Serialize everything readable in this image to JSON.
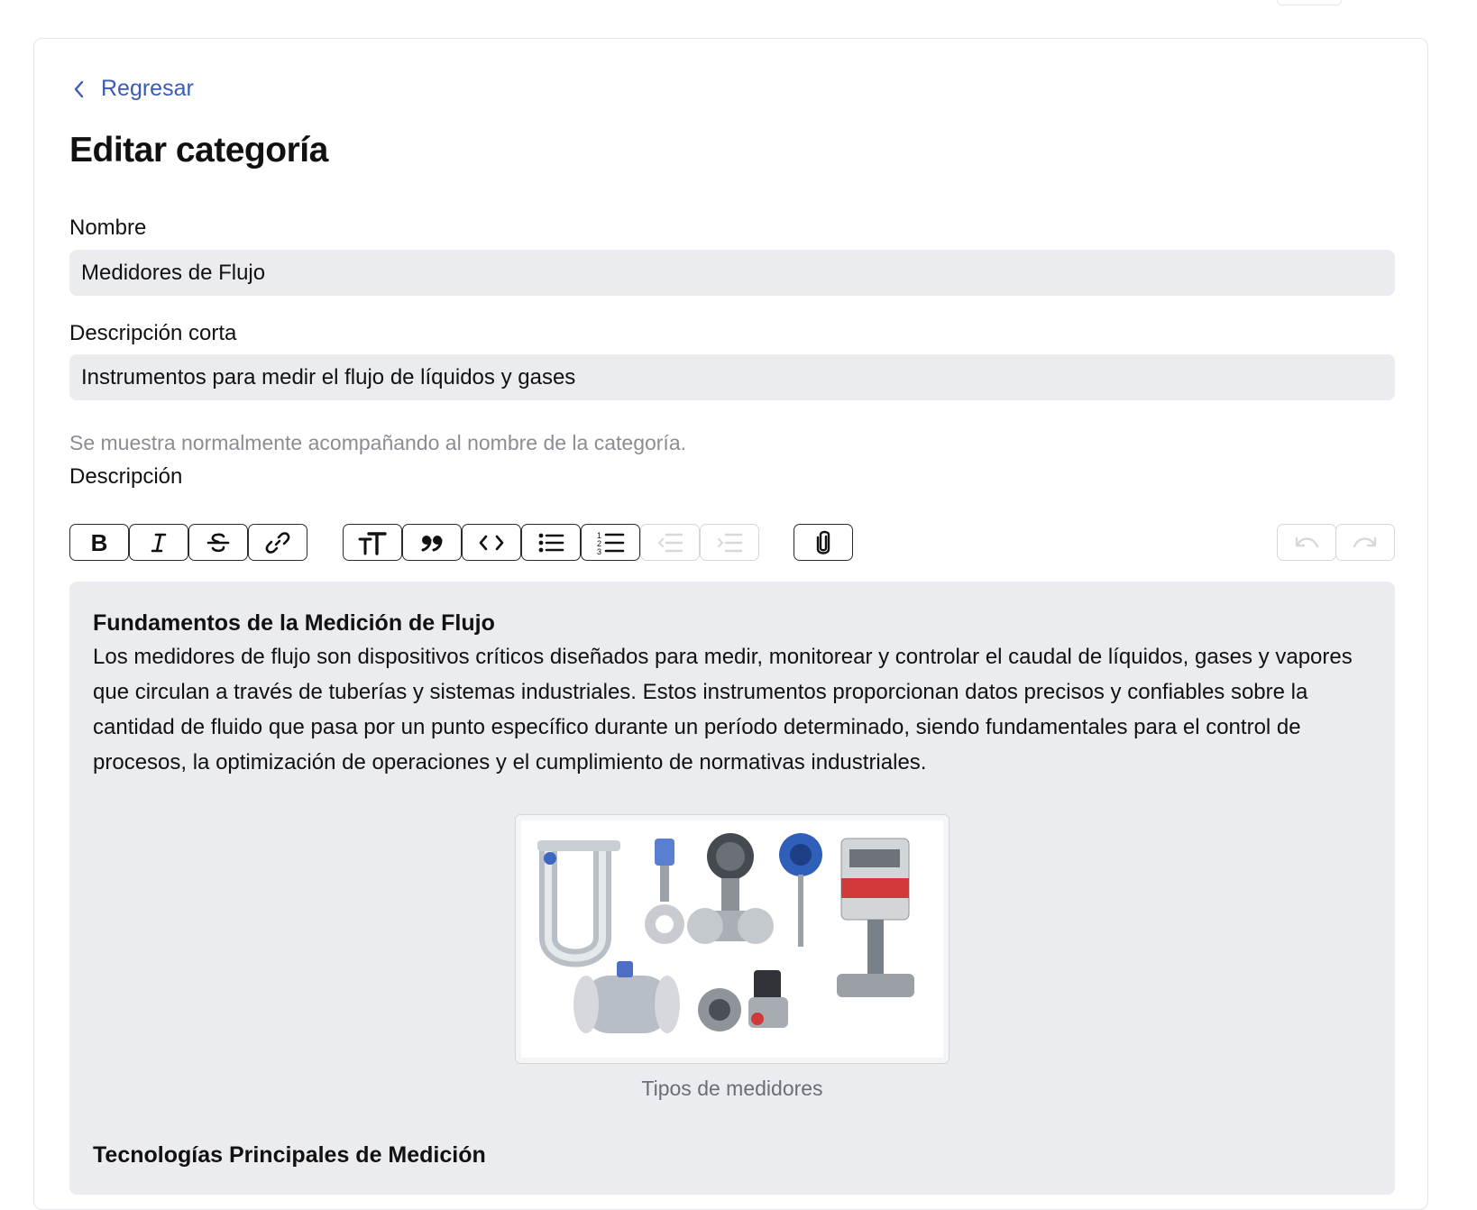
{
  "nav": {
    "back_label": "Regresar"
  },
  "page": {
    "title": "Editar categoría"
  },
  "form": {
    "name": {
      "label": "Nombre",
      "value": "Medidores de Flujo"
    },
    "short_description": {
      "label": "Descripción corta",
      "value": "Instrumentos para medir el flujo de líquidos y gases",
      "hint": "Se muestra normalmente acompañando al nombre de la categoría."
    },
    "description": {
      "label": "Descripción"
    }
  },
  "toolbar": {
    "buttons": [
      {
        "icon": "bold-icon",
        "enabled": true
      },
      {
        "icon": "italic-icon",
        "enabled": true
      },
      {
        "icon": "strikethrough-icon",
        "enabled": true
      },
      {
        "icon": "link-icon",
        "enabled": true
      },
      {
        "icon": "heading-icon",
        "enabled": true
      },
      {
        "icon": "quote-icon",
        "enabled": true
      },
      {
        "icon": "code-icon",
        "enabled": true
      },
      {
        "icon": "bullet-list-icon",
        "enabled": true
      },
      {
        "icon": "numbered-list-icon",
        "enabled": true
      },
      {
        "icon": "outdent-icon",
        "enabled": false
      },
      {
        "icon": "indent-icon",
        "enabled": false
      },
      {
        "icon": "attach-icon",
        "enabled": true
      },
      {
        "icon": "undo-icon",
        "enabled": false
      },
      {
        "icon": "redo-icon",
        "enabled": false
      }
    ]
  },
  "editor": {
    "heading_1": "Fundamentos de la Medición de Flujo",
    "paragraph_1": "Los medidores de flujo son dispositivos críticos diseñados para medir, monitorear y controlar el caudal de líquidos, gases y vapores que circulan a través de tuberías y sistemas industriales. Estos instrumentos proporcionan datos precisos y confiables sobre la cantidad de fluido que pasa por un punto específico durante un período determinado, siendo fundamentales para el control de procesos, la optimización de operaciones y el cumplimiento de normativas industriales.",
    "image_caption": "Tipos de medidores",
    "heading_2": "Tecnologías Principales de Medición"
  },
  "colors": {
    "link": "#3b5bb5",
    "input_bg": "#ebecef",
    "hint": "#8a8d93",
    "disabled_border": "#d6d8dc"
  }
}
